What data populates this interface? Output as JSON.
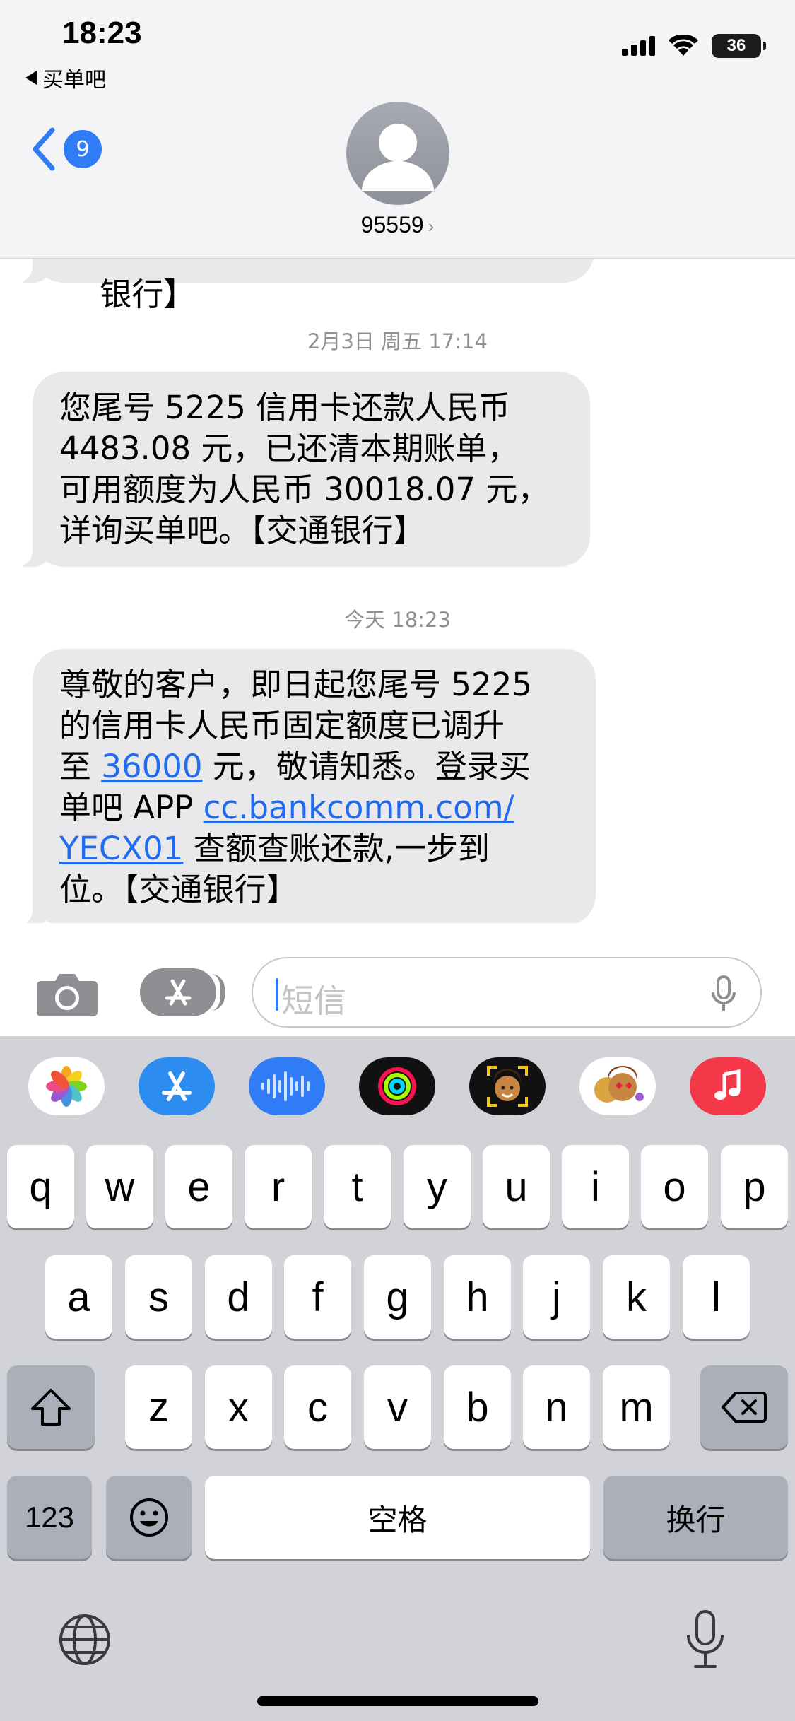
{
  "status_bar": {
    "time": "18:23",
    "back_app": "买单吧",
    "battery": "36"
  },
  "nav": {
    "unread_count": "9",
    "contact": "95559",
    "contact_chevron": "›"
  },
  "messages": [
    {
      "kind": "partial",
      "text": "银行】"
    },
    {
      "kind": "timestamp",
      "date": "2月3日 周五",
      "time": "17:14"
    },
    {
      "kind": "incoming",
      "text": "您尾号 5225 信用卡还款人民币\n4483.08 元，已还清本期账单，\n可用额度为人民币 30018.07 元，\n详询买单吧。【交通银行】"
    },
    {
      "kind": "timestamp",
      "date": "今天",
      "time": "18:23"
    },
    {
      "kind": "incoming",
      "text_1": "尊敬的客户，即日起您尾号 5225\n的信用卡人民币固定额度已调升\n至 ",
      "link_amount": "36000",
      "text_2": " 元，敬请知悉。登录买\n单吧 APP ",
      "link_url_1": "cc.bankcomm.com/",
      "text_3": "\n",
      "link_url_2": "YECX01",
      "text_4": " 查额查账还款,一步到\n位。【交通银行】"
    }
  ],
  "composer": {
    "placeholder": "短信"
  },
  "keyboard": {
    "apps": [
      "photos-app",
      "app-store-app",
      "audio-message-app",
      "activity-app",
      "memoji-app",
      "memoji-stickers-app",
      "music-app"
    ],
    "row1": [
      "q",
      "w",
      "e",
      "r",
      "t",
      "y",
      "u",
      "i",
      "o",
      "p"
    ],
    "row2": [
      "a",
      "s",
      "d",
      "f",
      "g",
      "h",
      "j",
      "k",
      "l"
    ],
    "row3": [
      "z",
      "x",
      "c",
      "v",
      "b",
      "n",
      "m"
    ],
    "numbers_key": "123",
    "space_key": "空格",
    "return_key": "换行"
  }
}
